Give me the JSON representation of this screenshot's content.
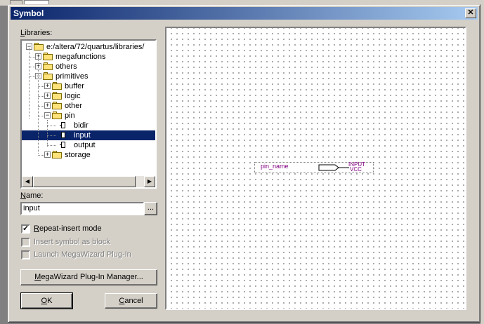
{
  "window": {
    "title": "Symbol",
    "close_glyph": "✕"
  },
  "libraries": {
    "label_prefix": "",
    "label_accel": "L",
    "label_rest": "ibraries:",
    "tree": [
      {
        "label": "e:/altera/72/quartus/libraries/",
        "level": 0,
        "expander": "−",
        "icon": "open-folder-icon"
      },
      {
        "label": "megafunctions",
        "level": 1,
        "expander": "+",
        "icon": "folder-icon"
      },
      {
        "label": "others",
        "level": 1,
        "expander": "+",
        "icon": "folder-icon"
      },
      {
        "label": "primitives",
        "level": 1,
        "expander": "−",
        "icon": "open-folder-icon"
      },
      {
        "label": "buffer",
        "level": 2,
        "expander": "+",
        "icon": "folder-icon"
      },
      {
        "label": "logic",
        "level": 2,
        "expander": "+",
        "icon": "folder-icon"
      },
      {
        "label": "other",
        "level": 2,
        "expander": "+",
        "icon": "folder-icon"
      },
      {
        "label": "pin",
        "level": 2,
        "expander": "−",
        "icon": "open-folder-icon"
      },
      {
        "label": "bidir",
        "level": 3,
        "expander": "",
        "icon": "pin-symbol-icon"
      },
      {
        "label": "input",
        "level": 3,
        "expander": "",
        "icon": "pin-symbol-icon",
        "selected": true
      },
      {
        "label": "output",
        "level": 3,
        "expander": "",
        "icon": "pin-symbol-icon"
      },
      {
        "label": "storage",
        "level": 2,
        "expander": "+",
        "icon": "folder-icon"
      }
    ],
    "scroll_left": "◀",
    "scroll_right": "▶"
  },
  "name": {
    "label_accel": "N",
    "label_rest": "ame:",
    "value": "input",
    "browse_label": "..."
  },
  "options": {
    "repeat_insert": {
      "accel": "R",
      "rest": "epeat-insert mode",
      "checked": true,
      "check_glyph": "✓"
    },
    "insert_as_block": {
      "label": "Insert symbol as block",
      "disabled": true
    },
    "launch_megawizard": {
      "label": "Launch MegaWizard Plug-In",
      "disabled": true
    }
  },
  "buttons": {
    "megawizard_accel": "M",
    "megawizard_rest": "egaWizard Plug-In Manager...",
    "ok_accel": "O",
    "ok_rest": "K",
    "cancel_prefix": "",
    "cancel_accel": "C",
    "cancel_rest": "ancel"
  },
  "preview": {
    "pin_name": "pin_name",
    "pin_type": "INPUT",
    "pin_default": "VCC"
  }
}
